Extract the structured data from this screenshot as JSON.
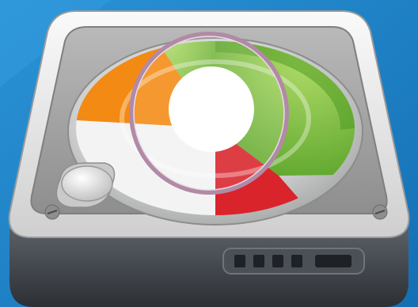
{
  "icon": {
    "name": "disk-usage-analyzer-icon",
    "colors": {
      "background": "#1b7fc4",
      "chassis_top": "#f0f0ee",
      "chassis_bottom": "#3b3f45",
      "platter": "#d7d8d8",
      "green": "#8cc63f",
      "green_dark": "#4e9a22",
      "orange": "#f38a13",
      "red": "#d9242b",
      "white": "#ffffff",
      "lens_ring": "#b18aa6"
    },
    "chart_slices": [
      {
        "name": "green",
        "fraction": 0.55
      },
      {
        "name": "red",
        "fraction": 0.12
      },
      {
        "name": "white",
        "fraction": 0.19
      },
      {
        "name": "orange",
        "fraction": 0.14
      }
    ]
  }
}
